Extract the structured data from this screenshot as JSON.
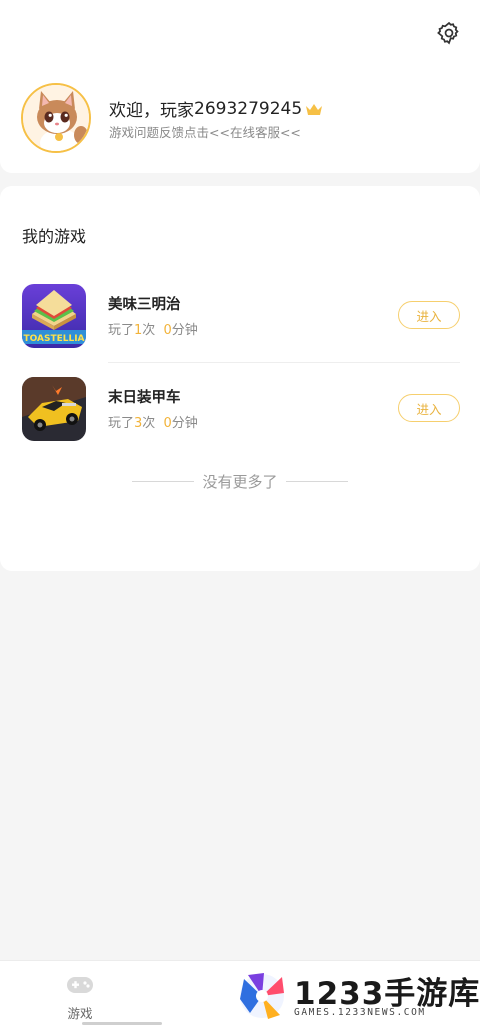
{
  "profile": {
    "welcome_prefix": "欢迎，玩家",
    "player_id": "2693279245",
    "feedback_text": "游戏问题反馈点击<<在线客服<<"
  },
  "games_section": {
    "title": "我的游戏",
    "items": [
      {
        "name": "美味三明治",
        "icon": "sandwich-game-icon",
        "stats_prefix": "玩了",
        "play_count": "1",
        "count_unit": "次",
        "minutes": "0",
        "minutes_unit": "分钟",
        "enter_label": "进入"
      },
      {
        "name": "末日装甲车",
        "icon": "armored-car-game-icon",
        "stats_prefix": "玩了",
        "play_count": "3",
        "count_unit": "次",
        "minutes": "0",
        "minutes_unit": "分钟",
        "enter_label": "进入"
      }
    ],
    "no_more_text": "没有更多了"
  },
  "bottom_bar": {
    "tab_game_label": "游戏"
  },
  "watermark": {
    "brand": "1233手游库",
    "url": "GAMES.1233NEWS.COM"
  },
  "colors": {
    "accent": "#f2b33a",
    "button_border": "#f6cf6e",
    "background": "#f5f5f5"
  }
}
